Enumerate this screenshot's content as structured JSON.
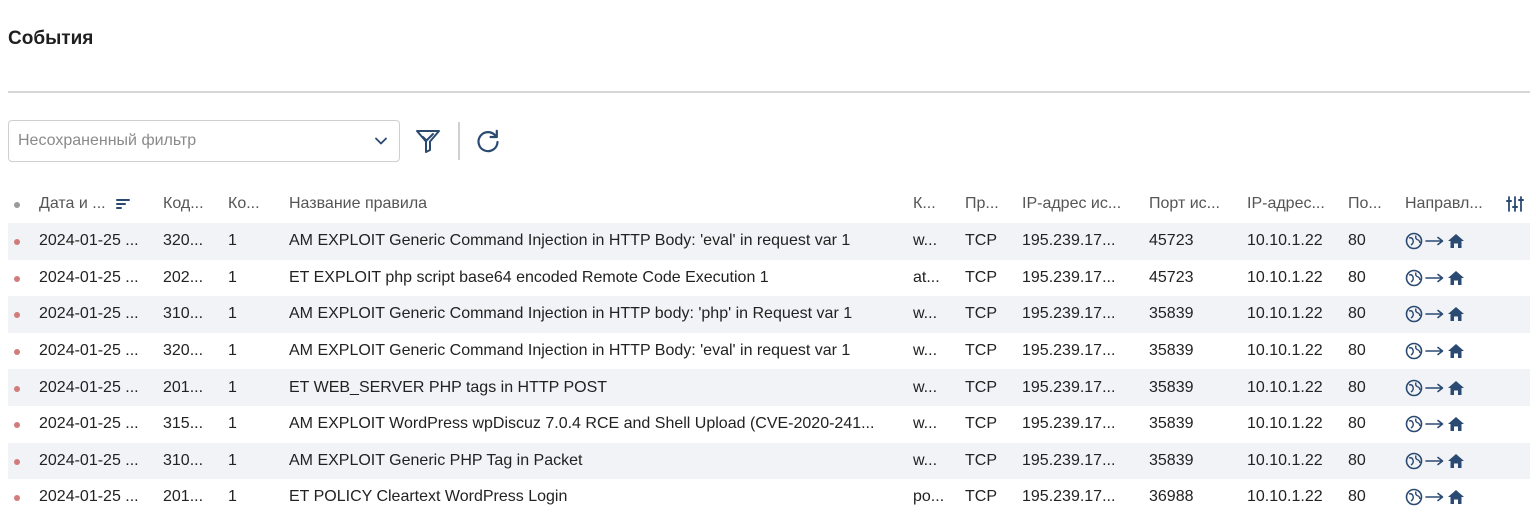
{
  "page": {
    "title": "События"
  },
  "toolbar": {
    "filter_placeholder": "Несохраненный фильтр",
    "icons": {
      "dropdown": "chevron-down-icon",
      "filter": "filter-check-icon",
      "refresh": "refresh-icon"
    }
  },
  "colors": {
    "accent": "#2b4a72",
    "event_dot": "#d17c7c",
    "row_alt": "#f1f3f6",
    "divider": "#d6d6d6"
  },
  "table": {
    "headers": {
      "date": "Дата и ...",
      "code": "Код...",
      "count": "Ко...",
      "name": "Название правила",
      "category": "К...",
      "protocol": "Пр...",
      "src_ip": "IP-адрес ис...",
      "src_port": "Порт ис...",
      "dst_ip": "IP-адрес...",
      "dst_port": "По...",
      "direction": "Направл..."
    },
    "rows": [
      {
        "date": "2024-01-25 ...",
        "code": "320...",
        "count": "1",
        "name": "AM EXPLOIT Generic Command Injection in HTTP Body: 'eval' in request var 1",
        "category": "w...",
        "protocol": "TCP",
        "src_ip": "195.239.17...",
        "src_port": "45723",
        "dst_ip": "10.10.1.22",
        "dst_port": "80"
      },
      {
        "date": "2024-01-25 ...",
        "code": "202...",
        "count": "1",
        "name": "ET EXPLOIT php script base64 encoded Remote Code Execution 1",
        "category": "at...",
        "protocol": "TCP",
        "src_ip": "195.239.17...",
        "src_port": "45723",
        "dst_ip": "10.10.1.22",
        "dst_port": "80"
      },
      {
        "date": "2024-01-25 ...",
        "code": "310...",
        "count": "1",
        "name": "AM EXPLOIT Generic Command Injection in HTTP body: 'php' in Request var 1",
        "category": "w...",
        "protocol": "TCP",
        "src_ip": "195.239.17...",
        "src_port": "35839",
        "dst_ip": "10.10.1.22",
        "dst_port": "80"
      },
      {
        "date": "2024-01-25 ...",
        "code": "320...",
        "count": "1",
        "name": "AM EXPLOIT Generic Command Injection in HTTP Body: 'eval' in request var 1",
        "category": "w...",
        "protocol": "TCP",
        "src_ip": "195.239.17...",
        "src_port": "35839",
        "dst_ip": "10.10.1.22",
        "dst_port": "80"
      },
      {
        "date": "2024-01-25 ...",
        "code": "201...",
        "count": "1",
        "name": "ET WEB_SERVER PHP tags in HTTP POST",
        "category": "w...",
        "protocol": "TCP",
        "src_ip": "195.239.17...",
        "src_port": "35839",
        "dst_ip": "10.10.1.22",
        "dst_port": "80"
      },
      {
        "date": "2024-01-25 ...",
        "code": "315...",
        "count": "1",
        "name": "AM EXPLOIT WordPress wpDiscuz 7.0.4 RCE and Shell Upload (CVE-2020-241...",
        "category": "w...",
        "protocol": "TCP",
        "src_ip": "195.239.17...",
        "src_port": "35839",
        "dst_ip": "10.10.1.22",
        "dst_port": "80"
      },
      {
        "date": "2024-01-25 ...",
        "code": "310...",
        "count": "1",
        "name": "AM EXPLOIT Generic PHP Tag in Packet",
        "category": "w...",
        "protocol": "TCP",
        "src_ip": "195.239.17...",
        "src_port": "35839",
        "dst_ip": "10.10.1.22",
        "dst_port": "80"
      },
      {
        "date": "2024-01-25 ...",
        "code": "201...",
        "count": "1",
        "name": "ET POLICY Cleartext WordPress Login",
        "category": "po...",
        "protocol": "TCP",
        "src_ip": "195.239.17...",
        "src_port": "36988",
        "dst_ip": "10.10.1.22",
        "dst_port": "80"
      }
    ],
    "direction_icons": [
      "globe-icon",
      "arrow-right-icon",
      "home-icon"
    ]
  }
}
